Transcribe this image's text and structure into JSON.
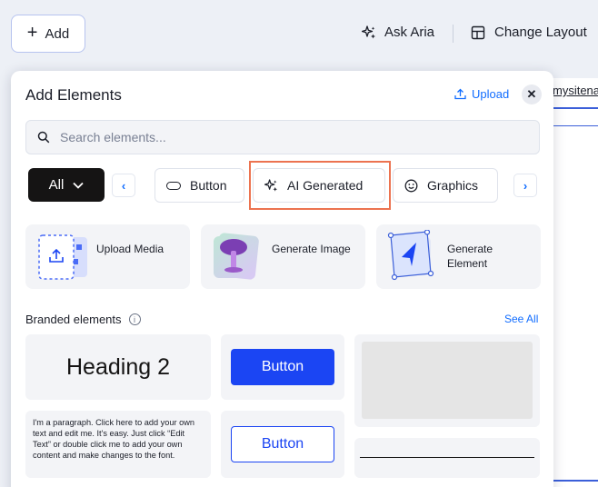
{
  "topbar": {
    "add_label": "Add",
    "ask_aria_label": "Ask Aria",
    "change_layout_label": "Change Layout"
  },
  "background": {
    "site_link": "mysitena"
  },
  "panel": {
    "title": "Add Elements",
    "upload_label": "Upload",
    "search": {
      "placeholder": "Search elements..."
    },
    "filter": {
      "all_label": "All",
      "chips": [
        "Button",
        "AI Generated",
        "Graphics"
      ],
      "selected": "AI Generated"
    },
    "features": [
      {
        "label": "Upload Media",
        "icon": "upload-media-icon"
      },
      {
        "label": "Generate Image",
        "icon": "generate-image-icon"
      },
      {
        "label": "Generate Element",
        "icon": "generate-element-icon"
      }
    ],
    "branded": {
      "title": "Branded elements",
      "see_all": "See All",
      "heading_sample": "Heading 2",
      "button_filled": "Button",
      "button_outline": "Button",
      "paragraph": "I'm a paragraph. Click here to add your own text and edit me. It's easy. Just click “Edit Text” or double click me to add your own content and make changes to the font."
    }
  },
  "colors": {
    "accent": "#116dff",
    "brand_button": "#1b45f3",
    "highlight": "#ec7350",
    "dark": "#151414"
  }
}
